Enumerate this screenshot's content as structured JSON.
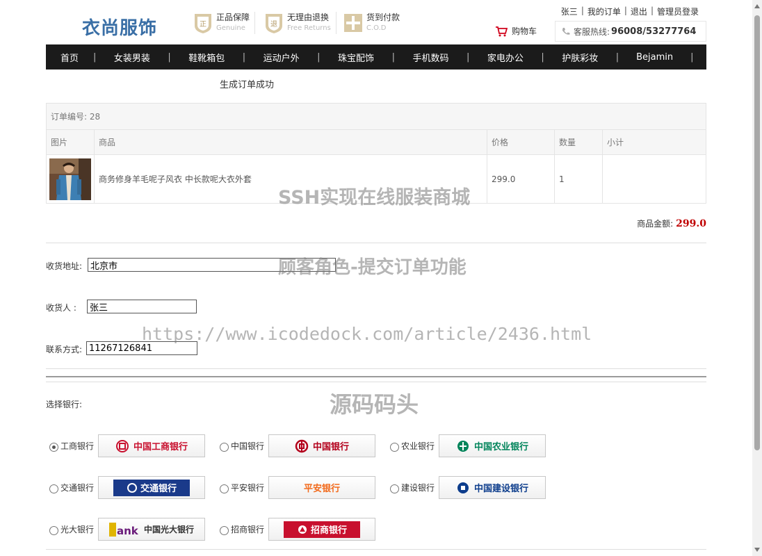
{
  "header": {
    "logo": "衣尚服饰",
    "promises": [
      {
        "title": "正品保障",
        "sub": "Genuine",
        "icon": "genuine-badge-icon"
      },
      {
        "title": "无理由退换",
        "sub": "Free Returns",
        "icon": "return-badge-icon"
      },
      {
        "title": "货到付款",
        "sub": "C.O.D",
        "icon": "cod-badge-icon"
      }
    ],
    "links": {
      "user": "张三",
      "orders": "我的订单",
      "logout": "退出",
      "admin": "管理员登录"
    },
    "cart": "购物车",
    "hotline_label": "客服热线:",
    "hotline_number": "96008/53277764"
  },
  "nav": [
    "首页",
    "女装男装",
    "鞋靴箱包",
    "运动户外",
    "珠宝配饰",
    "手机数码",
    "家电办公",
    "护肤彩妆",
    "Bejamin"
  ],
  "order": {
    "success": "生成订单成功",
    "id_label": "订单编号:",
    "id": "28",
    "columns": [
      "图片",
      "商品",
      "价格",
      "数量",
      "小计"
    ],
    "items": [
      {
        "name": "商务修身羊毛呢子风衣 中长款呢大衣外套",
        "price": "299.0",
        "qty": "1",
        "subtotal": ""
      }
    ],
    "amount_label": "商品金额:",
    "amount": "299.0"
  },
  "form": {
    "address_label": "收货地址:",
    "address": "北京市",
    "receiver_label": "收货人 :",
    "receiver": "张三",
    "phone_label": "联系方式:",
    "phone": "11267126841"
  },
  "banks": {
    "title": "选择银行:",
    "list": [
      {
        "name": "工商银行",
        "logo": "中国工商银行",
        "color": "#c8102e",
        "checked": true
      },
      {
        "name": "中国银行",
        "logo": "中国银行",
        "color": "#b3001b",
        "checked": false
      },
      {
        "name": "农业银行",
        "logo": "中国农业银行",
        "color": "#00845a",
        "checked": false
      },
      {
        "name": "交通银行",
        "logo": "交通银行",
        "color": "#1a3a8a",
        "checked": false
      },
      {
        "name": "平安银行",
        "logo": "平安银行",
        "color": "#f26b1d",
        "checked": false
      },
      {
        "name": "建设银行",
        "logo": "中国建设银行",
        "color": "#0d3d8c",
        "checked": false
      },
      {
        "name": "光大银行",
        "logo": "中国光大银行",
        "color": "#6a1b7a",
        "checked": false
      },
      {
        "name": "招商银行",
        "logo": "招商银行",
        "color": "#c8102e",
        "checked": false
      }
    ]
  },
  "watermarks": {
    "w1": "SSH实现在线服装商城",
    "w2": "顾客角色-提交订单功能",
    "w3": "https://www.icodedock.com/article/2436.html",
    "w4": "源码码头"
  }
}
